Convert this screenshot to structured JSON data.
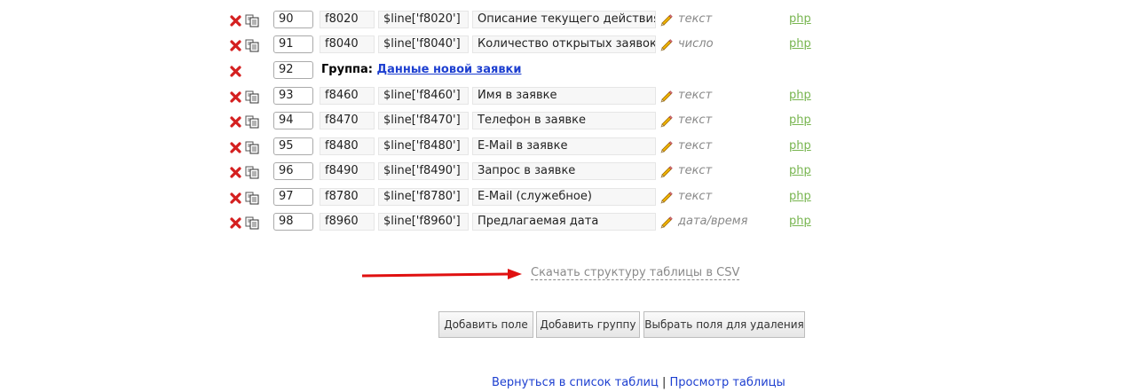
{
  "rows": [
    {
      "kind": "field",
      "num": "90",
      "code": "f8020",
      "var": "$line['f8020']",
      "name": "Описание текущего действия",
      "type": "текст",
      "php": "php"
    },
    {
      "kind": "field",
      "num": "91",
      "code": "f8040",
      "var": "$line['f8040']",
      "name": "Количество открытых заявок",
      "type": "число",
      "php": "php"
    },
    {
      "kind": "group",
      "num": "92",
      "group_label": "Группа:",
      "group_name": "Данные новой заявки"
    },
    {
      "kind": "field",
      "num": "93",
      "code": "f8460",
      "var": "$line['f8460']",
      "name": "Имя в заявке",
      "type": "текст",
      "php": "php"
    },
    {
      "kind": "field",
      "num": "94",
      "code": "f8470",
      "var": "$line['f8470']",
      "name": "Телефон в заявке",
      "type": "текст",
      "php": "php"
    },
    {
      "kind": "field",
      "num": "95",
      "code": "f8480",
      "var": "$line['f8480']",
      "name": "E-Mail в заявке",
      "type": "текст",
      "php": "php"
    },
    {
      "kind": "field",
      "num": "96",
      "code": "f8490",
      "var": "$line['f8490']",
      "name": "Запрос в заявке",
      "type": "текст",
      "php": "php"
    },
    {
      "kind": "field",
      "num": "97",
      "code": "f8780",
      "var": "$line['f8780']",
      "name": "E-Mail (служебное)",
      "type": "текст",
      "php": "php"
    },
    {
      "kind": "field",
      "num": "98",
      "code": "f8960",
      "var": "$line['f8960']",
      "name": "Предлагаемая дата",
      "type": "дата/время",
      "php": "php"
    }
  ],
  "csv_link": "Скачать структуру таблицы в CSV",
  "buttons": {
    "add_field": "Добавить поле",
    "add_group": "Добавить группу",
    "select_delete": "Выбрать поля для удаления"
  },
  "footer": {
    "back_link": "Вернуться в список таблиц",
    "separator": "|",
    "view_link": "Просмотр таблицы"
  },
  "colors": {
    "delete_icon": "#d42020",
    "arrow": "#e01010",
    "php_link": "#78b550",
    "link": "#1d3fd0"
  },
  "icons": {
    "delete": "delete-x-icon",
    "copy": "copy-icon",
    "edit": "pencil-icon"
  }
}
